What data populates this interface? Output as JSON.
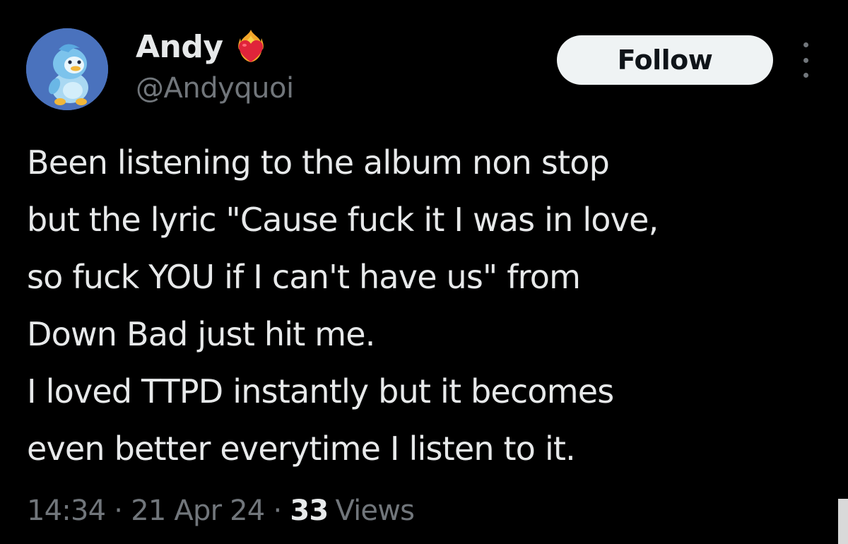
{
  "author": {
    "display_name": "Andy",
    "handle": "@Andyquoi",
    "avatar_icon": "penguin-avatar-icon",
    "badge_icon": "heart-on-fire-emoji-icon"
  },
  "actions": {
    "follow_label": "Follow",
    "more_icon": "more-vertical-icon"
  },
  "tweet": {
    "lines": [
      "Been listening to the album non stop",
      "but the lyric \"Cause fuck it I was in love,",
      "so fuck YOU if I can't have us\" from",
      "Down Bad just hit me.",
      "I loved TTPD instantly but it becomes",
      "even better everytime I listen to it."
    ]
  },
  "meta": {
    "time": "14:34",
    "separator": "·",
    "date": "21 Apr 24",
    "views_count": "33",
    "views_label": "Views"
  },
  "colors": {
    "background": "#000000",
    "primary_text": "#e7e9ea",
    "secondary_text": "#71767b",
    "follow_bg": "#eff3f4",
    "follow_text": "#0f1419"
  }
}
